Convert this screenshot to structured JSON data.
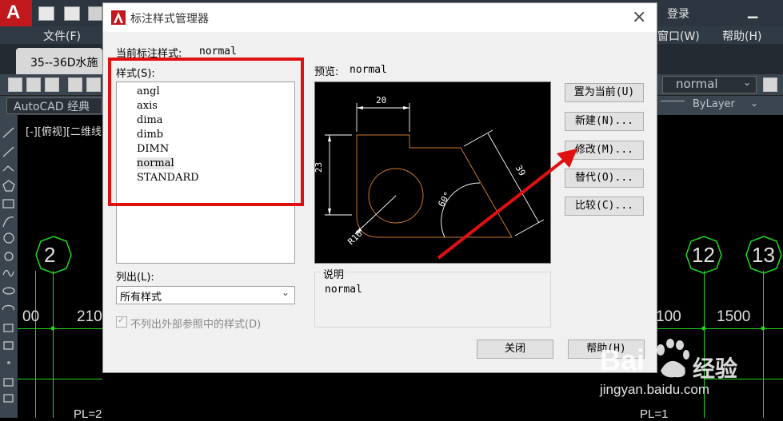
{
  "app": {
    "menu_file": "文件(F)",
    "menu_window": "窗口(W)",
    "menu_help": "帮助(H)",
    "login": "登录",
    "doc_tab": "35--36D水施",
    "workspace": "AutoCAD 经典",
    "viewport_label": "[-][俯视][二维线",
    "style_combo": "normal",
    "layer_combo": "ByLayer",
    "logo_letter": "A"
  },
  "drawing": {
    "circle_labels": [
      "2",
      "12",
      "13"
    ],
    "dims": [
      "00",
      "210",
      "100",
      "1500"
    ],
    "bottom_left": "PL=2",
    "bottom_right": "PL=1"
  },
  "dialog": {
    "title": "标注样式管理器",
    "current_label": "当前标注样式:",
    "current_value": "normal",
    "styles_label": "样式(S):",
    "styles": [
      "angl",
      "axis",
      "dima",
      "dimb",
      "DIMN",
      "normal",
      "STANDARD"
    ],
    "selected_style": "normal",
    "list_label": "列出(L):",
    "list_value": "所有样式",
    "checkbox_label": "不列出外部参照中的样式(D)",
    "preview_label": "预览:",
    "preview_value": "normal",
    "preview_dims": {
      "top": "20",
      "left": "23",
      "right": "39",
      "angle": "60°",
      "radius": "R16"
    },
    "desc_label": "说明",
    "desc_value": "normal",
    "buttons": {
      "set_current": "置为当前(U)",
      "new": "新建(N)...",
      "modify": "修改(M)...",
      "override": "替代(O)...",
      "compare": "比较(C)...",
      "close": "关闭",
      "help": "帮助(H)"
    },
    "close_icon": "close-icon"
  },
  "watermark": {
    "brand": "Bai",
    "brand_cn": "经验",
    "url": "jingyan.baidu.com"
  },
  "colors": {
    "highlight": "#e01010",
    "grid": "#1fd81f",
    "preview_line": "#c87830"
  }
}
